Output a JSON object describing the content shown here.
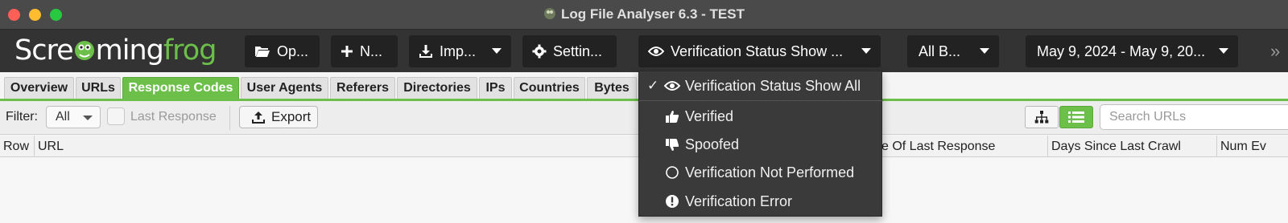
{
  "window": {
    "title": "Log File Analyser 6.3 - TEST"
  },
  "logo": {
    "text_a": "Scre",
    "text_b": "ming",
    "text_c": "frog"
  },
  "toolbar": {
    "open_label": "Op...",
    "new_label": "N...",
    "import_label": "Imp...",
    "settings_label": "Settin...",
    "verification_label": "Verification Status Show ...",
    "bots_label": "All B...",
    "date_range_label": "May 9, 2024 - May 9, 20...",
    "more_label": "»"
  },
  "tabs": [
    {
      "label": "Overview"
    },
    {
      "label": "URLs"
    },
    {
      "label": "Response Codes"
    },
    {
      "label": "User Agents"
    },
    {
      "label": "Referers"
    },
    {
      "label": "Directories"
    },
    {
      "label": "IPs"
    },
    {
      "label": "Countries"
    },
    {
      "label": "Bytes"
    }
  ],
  "filterbar": {
    "filter_label": "Filter:",
    "filter_value": "All",
    "last_response_label": "Last Response",
    "export_label": "Export",
    "search_placeholder": "Search URLs"
  },
  "table": {
    "columns": [
      "Row",
      "URL",
      "e Of Last Response",
      "Days Since Last Crawl",
      "Num Ev"
    ]
  },
  "dropdown": {
    "items": [
      {
        "label": "Verification Status Show All",
        "checked": "✓",
        "icon": "eye-icon"
      },
      {
        "label": "Verified",
        "icon": "thumbs-up-icon"
      },
      {
        "label": "Spoofed",
        "icon": "thumbs-down-icon"
      },
      {
        "label": "Verification Not Performed",
        "icon": "circle-outline-icon"
      },
      {
        "label": "Verification Error",
        "icon": "exclamation-circle-icon"
      }
    ]
  },
  "colors": {
    "accent": "#6cc04a",
    "toolbar_bg": "#333333",
    "button_bg": "#222222"
  }
}
